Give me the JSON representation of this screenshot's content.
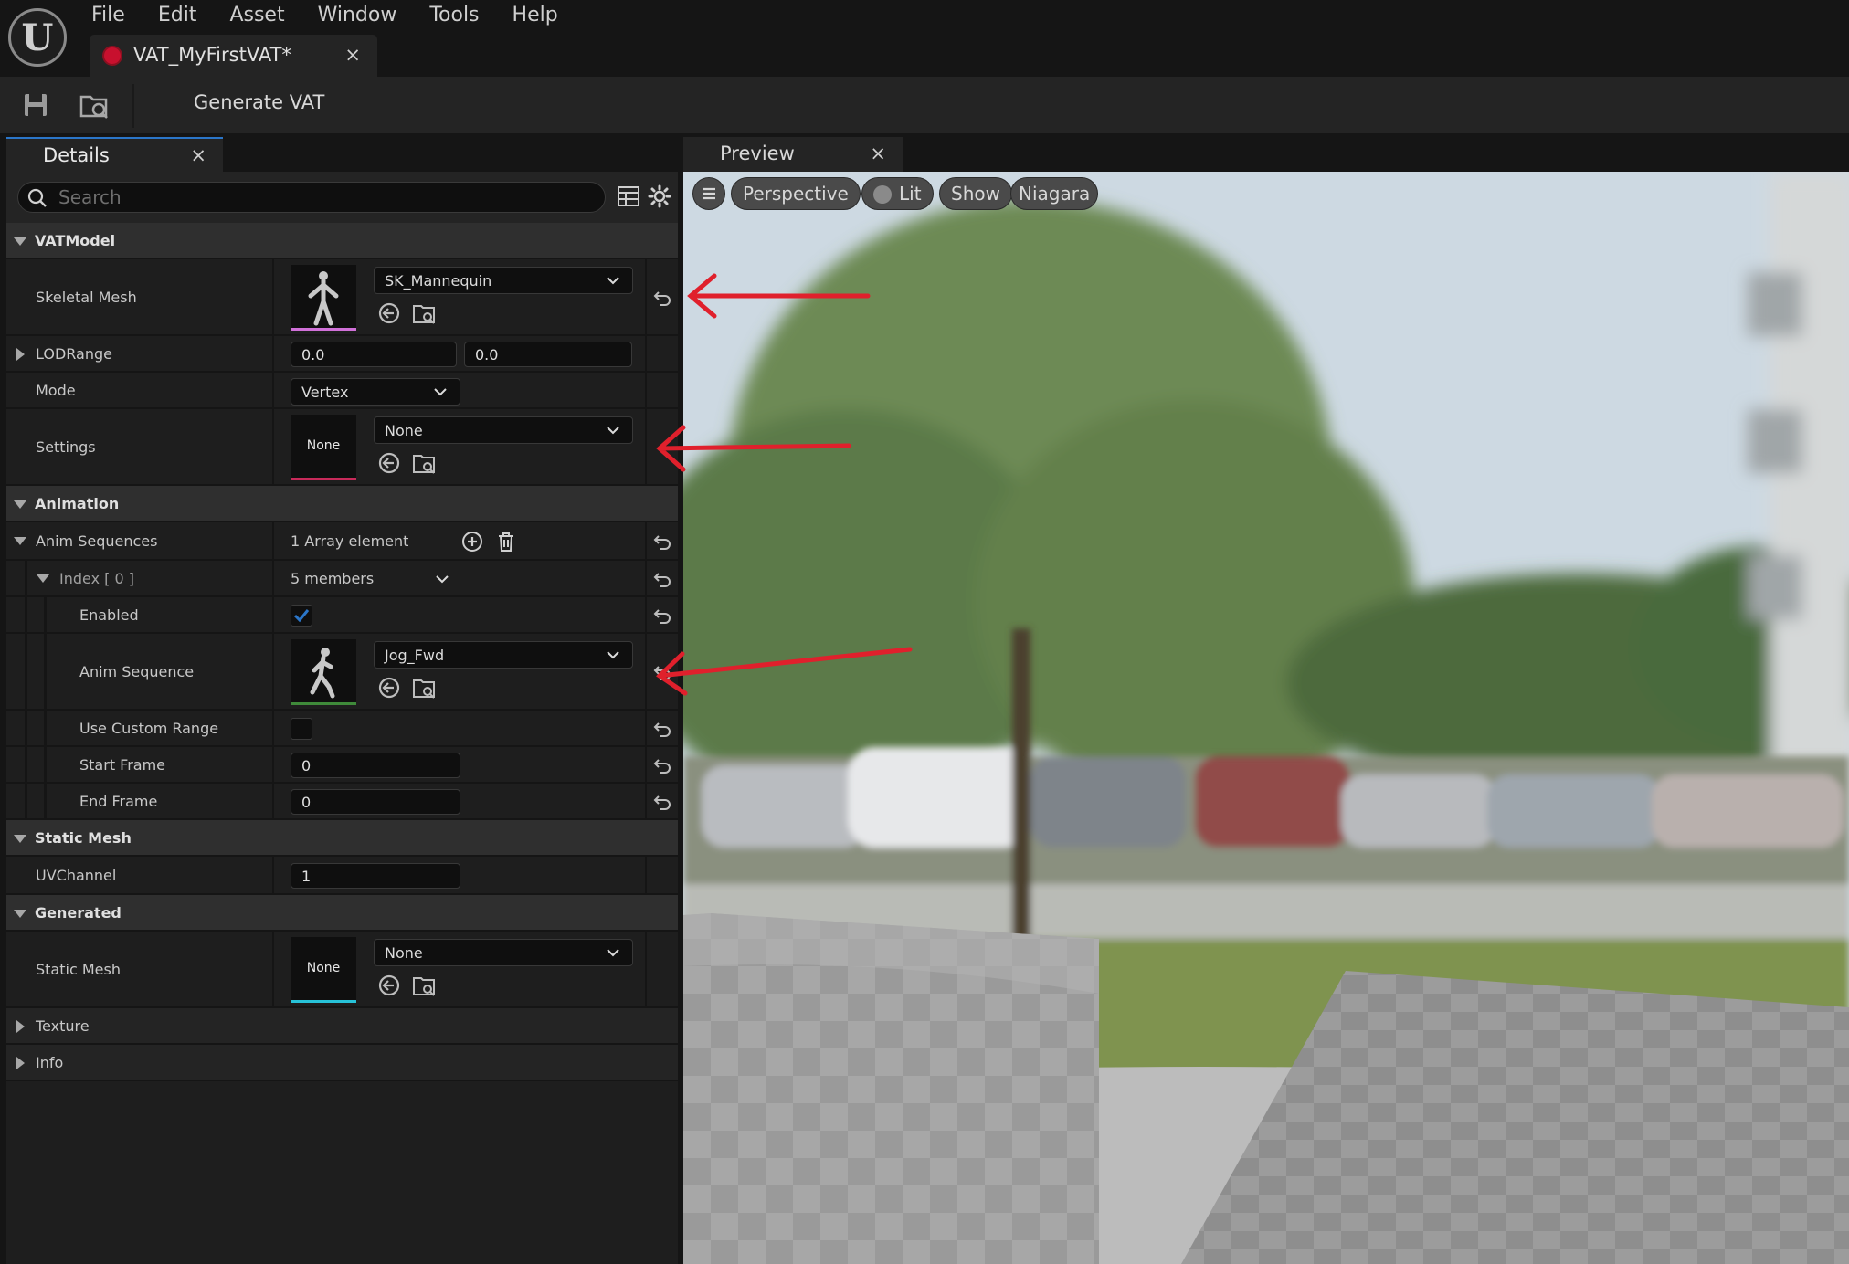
{
  "menu": [
    "File",
    "Edit",
    "Asset",
    "Window",
    "Tools",
    "Help"
  ],
  "document_tab": {
    "title": "VAT_MyFirstVAT*",
    "close": "×"
  },
  "toolbar": {
    "generate_label": "Generate VAT"
  },
  "details_tab": {
    "title": "Details",
    "close": "×"
  },
  "preview_tab": {
    "title": "Preview",
    "close": "×"
  },
  "search": {
    "placeholder": "Search"
  },
  "categories": {
    "vatmodel": "VATModel",
    "animation": "Animation",
    "static_mesh": "Static Mesh",
    "generated": "Generated",
    "texture": "Texture",
    "info": "Info"
  },
  "props": {
    "skeletal_mesh": {
      "label": "Skeletal Mesh",
      "value": "SK_Mannequin"
    },
    "lod_range": {
      "label": "LODRange",
      "min": "0.0",
      "max": "0.0"
    },
    "mode": {
      "label": "Mode",
      "value": "Vertex"
    },
    "settings": {
      "label": "Settings",
      "value": "None",
      "thumb": "None"
    },
    "anim_sequences": {
      "label": "Anim Sequences",
      "value": "1 Array element"
    },
    "index0": {
      "label": "Index [ 0 ]",
      "value": "5 members"
    },
    "enabled": {
      "label": "Enabled",
      "checked": true
    },
    "anim_sequence": {
      "label": "Anim Sequence",
      "value": "Jog_Fwd"
    },
    "use_custom_range": {
      "label": "Use Custom Range",
      "checked": false
    },
    "start_frame": {
      "label": "Start Frame",
      "value": "0"
    },
    "end_frame": {
      "label": "End Frame",
      "value": "0"
    },
    "uv_channel": {
      "label": "UVChannel",
      "value": "1"
    },
    "static_mesh_out": {
      "label": "Static Mesh",
      "value": "None",
      "thumb": "None"
    }
  },
  "viewport": {
    "buttons": {
      "perspective": "Perspective",
      "lit": "Lit",
      "show": "Show",
      "niagara": "Niagara"
    }
  },
  "colors": {
    "accent": "#2b76c9",
    "skeletal_strip": "#d070d8",
    "settings_strip": "#c82a5a",
    "anim_strip": "#3f8a3a",
    "static_strip": "#27c2d8",
    "annotation_arrow": "#e0202c"
  }
}
